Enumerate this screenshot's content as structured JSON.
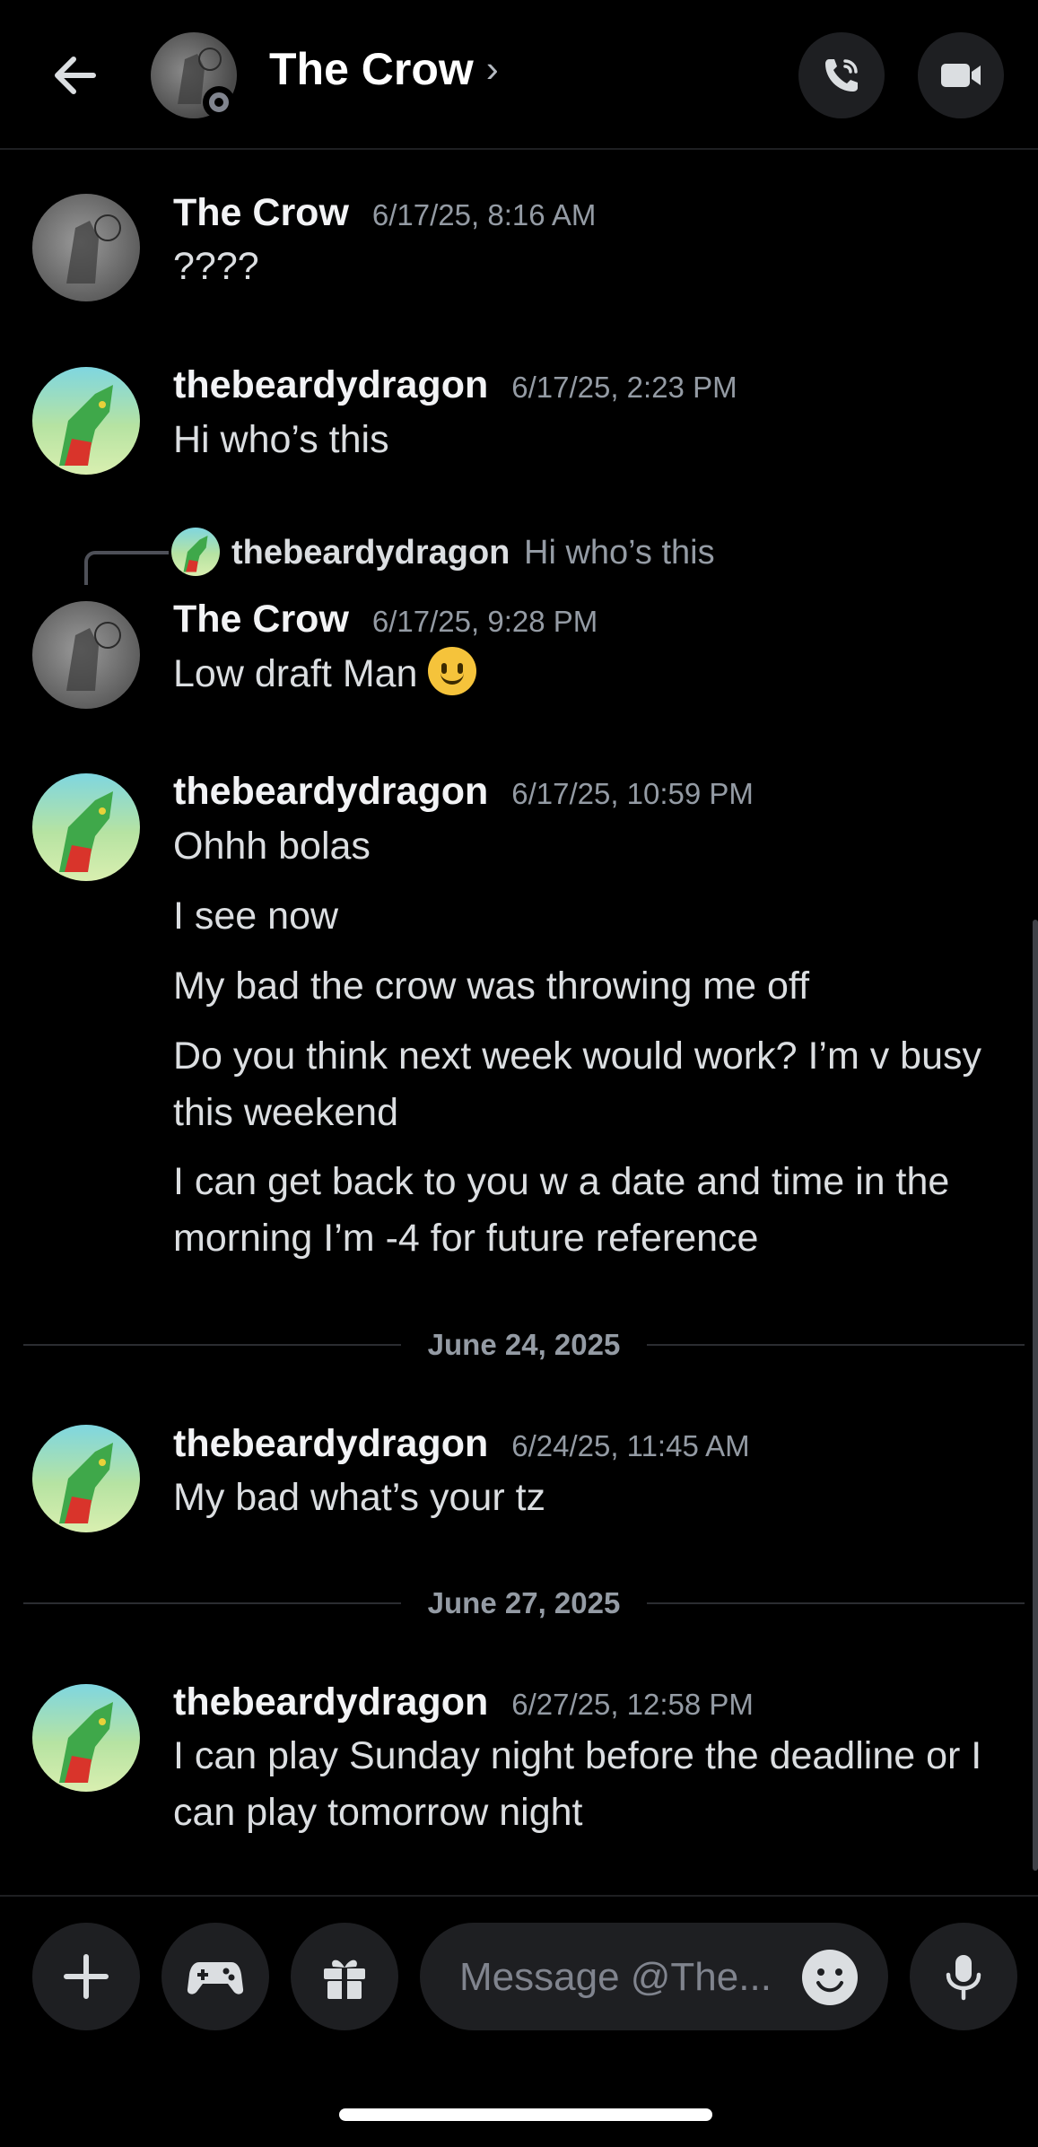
{
  "header": {
    "title": "The Crow",
    "chevron": "›",
    "icons": {
      "back": "arrow-left-icon",
      "call": "phone-call-icon",
      "video": "video-camera-icon"
    }
  },
  "messages": [
    {
      "author": "The Crow",
      "timestamp": "6/17/25, 8:16 AM",
      "lines": [
        "????"
      ]
    },
    {
      "author": "thebeardydragon",
      "timestamp": "6/17/25, 2:23 PM",
      "lines": [
        "Hi who’s this"
      ]
    },
    {
      "reply": {
        "author": "thebeardydragon",
        "text": "Hi who’s this"
      },
      "author": "The Crow",
      "timestamp": "6/17/25, 9:28 PM",
      "text": "Low draft Man",
      "emoji": "slightly-smiling-face-emoji"
    },
    {
      "author": "thebeardydragon",
      "timestamp": "6/17/25, 10:59 PM",
      "lines": [
        "Ohhh bolas",
        "I see now",
        "My bad the crow was throwing me off",
        "Do you think next week would work? I’m v busy this weekend",
        "I can get back to you w a date and time in the morning I’m -4 for future reference"
      ]
    },
    {
      "author": "thebeardydragon",
      "timestamp": "6/24/25, 11:45 AM",
      "lines": [
        "My bad what’s your tz"
      ]
    },
    {
      "author": "thebeardydragon",
      "timestamp": "6/27/25, 12:58 PM",
      "lines": [
        "I can play Sunday night before the deadline or I can play tomorrow night"
      ]
    }
  ],
  "dividers": [
    "June 24, 2025",
    "June 27, 2025"
  ],
  "composer": {
    "placeholder": "Message @The...",
    "icons": {
      "plus": "plus-icon",
      "games": "gamepad-icon",
      "gift": "gift-icon",
      "emoji": "emoji-smile-icon",
      "mic": "microphone-icon"
    }
  },
  "colors": {
    "background": "#000000",
    "surface": "#1e1f22",
    "muted": "#949ba4",
    "text": "#dbdee1"
  }
}
